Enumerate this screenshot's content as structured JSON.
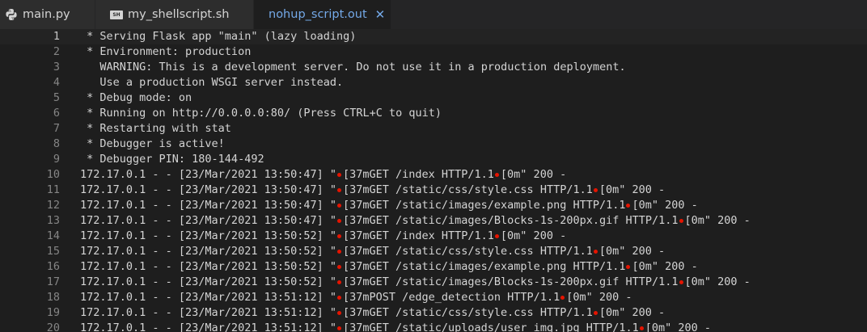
{
  "tabs": [
    {
      "label": "main.py",
      "icon": "python-icon",
      "active": false
    },
    {
      "label": "my_shellscript.sh",
      "icon": "shell-file-icon",
      "badge": "SH",
      "active": false
    },
    {
      "label": "nohup_script.out",
      "icon": "",
      "active": true,
      "close": "✕"
    }
  ],
  "colors": {
    "editor_bg": "#1e1e1e",
    "tab_bar_bg": "#252526",
    "active_tab_text": "#74a9e8",
    "line_number": "#858585",
    "escape_marker": "#e51400"
  },
  "escape_marker_icon": "control-character-marker",
  "editor": {
    "lines": [
      {
        "n": "1",
        "segments": [
          " * Serving Flask app \"main\" (lazy loading)"
        ]
      },
      {
        "n": "2",
        "segments": [
          " * Environment: production"
        ]
      },
      {
        "n": "3",
        "segments": [
          "   WARNING: This is a development server. Do not use it in a production deployment."
        ]
      },
      {
        "n": "4",
        "segments": [
          "   Use a production WSGI server instead."
        ]
      },
      {
        "n": "5",
        "segments": [
          " * Debug mode: on"
        ]
      },
      {
        "n": "6",
        "segments": [
          " * Running on http://0.0.0.0:80/ (Press CTRL+C to quit)"
        ]
      },
      {
        "n": "7",
        "segments": [
          " * Restarting with stat"
        ]
      },
      {
        "n": "8",
        "segments": [
          " * Debugger is active!"
        ]
      },
      {
        "n": "9",
        "segments": [
          " * Debugger PIN: 180-144-492"
        ]
      },
      {
        "n": "10",
        "segments": [
          "172.17.0.1 - - [23/Mar/2021 13:50:47] \"",
          "[37mGET /index HTTP/1.1",
          "[0m\" 200 -"
        ]
      },
      {
        "n": "11",
        "segments": [
          "172.17.0.1 - - [23/Mar/2021 13:50:47] \"",
          "[37mGET /static/css/style.css HTTP/1.1",
          "[0m\" 200 -"
        ]
      },
      {
        "n": "12",
        "segments": [
          "172.17.0.1 - - [23/Mar/2021 13:50:47] \"",
          "[37mGET /static/images/example.png HTTP/1.1",
          "[0m\" 200 -"
        ]
      },
      {
        "n": "13",
        "segments": [
          "172.17.0.1 - - [23/Mar/2021 13:50:47] \"",
          "[37mGET /static/images/Blocks-1s-200px.gif HTTP/1.1",
          "[0m\" 200 -"
        ]
      },
      {
        "n": "14",
        "segments": [
          "172.17.0.1 - - [23/Mar/2021 13:50:52] \"",
          "[37mGET /index HTTP/1.1",
          "[0m\" 200 -"
        ]
      },
      {
        "n": "15",
        "segments": [
          "172.17.0.1 - - [23/Mar/2021 13:50:52] \"",
          "[37mGET /static/css/style.css HTTP/1.1",
          "[0m\" 200 -"
        ]
      },
      {
        "n": "16",
        "segments": [
          "172.17.0.1 - - [23/Mar/2021 13:50:52] \"",
          "[37mGET /static/images/example.png HTTP/1.1",
          "[0m\" 200 -"
        ]
      },
      {
        "n": "17",
        "segments": [
          "172.17.0.1 - - [23/Mar/2021 13:50:52] \"",
          "[37mGET /static/images/Blocks-1s-200px.gif HTTP/1.1",
          "[0m\" 200 -"
        ]
      },
      {
        "n": "18",
        "segments": [
          "172.17.0.1 - - [23/Mar/2021 13:51:12] \"",
          "[37mPOST /edge_detection HTTP/1.1",
          "[0m\" 200 -"
        ]
      },
      {
        "n": "19",
        "segments": [
          "172.17.0.1 - - [23/Mar/2021 13:51:12] \"",
          "[37mGET /static/css/style.css HTTP/1.1",
          "[0m\" 200 -"
        ]
      },
      {
        "n": "20",
        "segments": [
          "172.17.0.1 - - [23/Mar/2021 13:51:12] \"",
          "[37mGET /static/uploads/user_img.jpg HTTP/1.1",
          "[0m\" 200 -"
        ]
      }
    ]
  }
}
